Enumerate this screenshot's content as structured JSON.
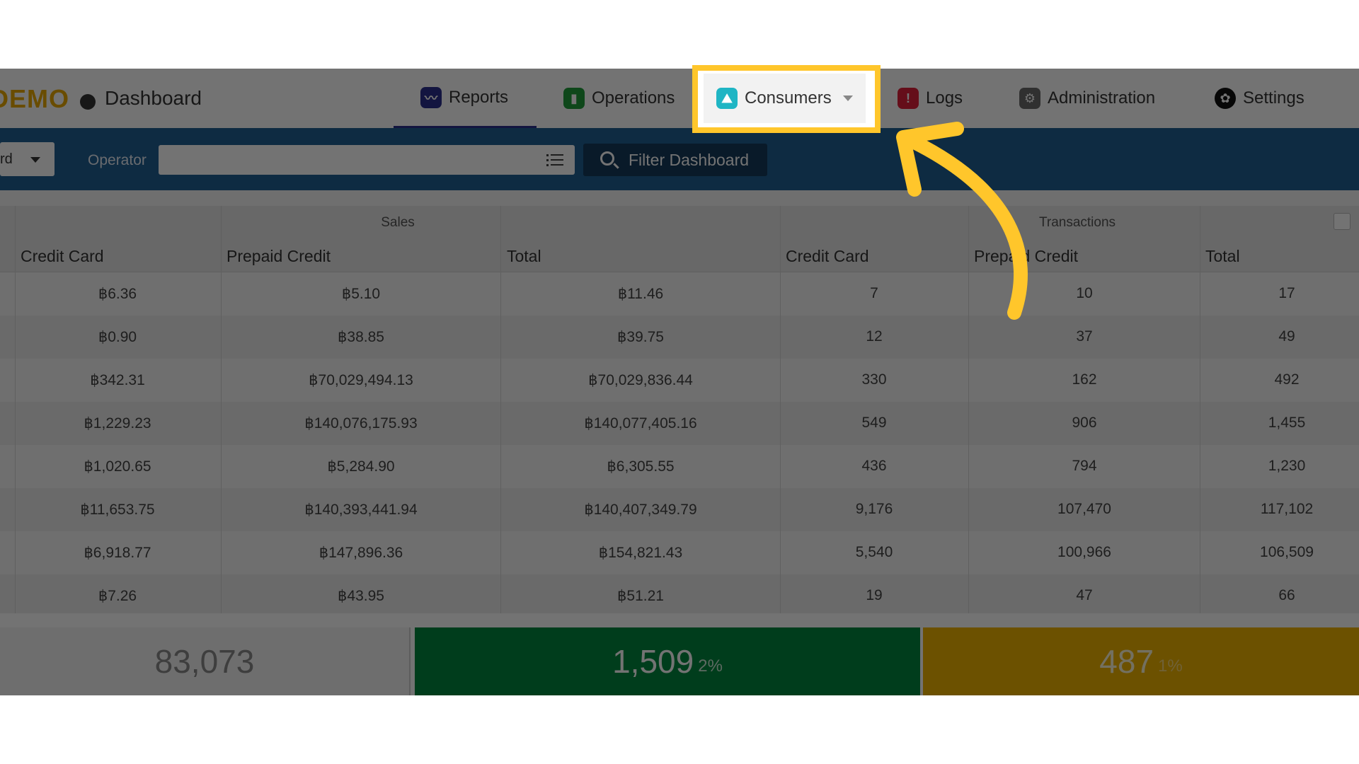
{
  "header": {
    "brand": "DEMO",
    "dashboard_label": "Dashboard"
  },
  "nav": {
    "reports": "Reports",
    "operations": "Operations",
    "consumers": "Consumers",
    "logs": "Logs",
    "administration": "Administration",
    "settings": "Settings"
  },
  "filters": {
    "partial_select_value": "rd",
    "operator_label": "Operator",
    "operator_value": "",
    "filter_button": "Filter Dashboard"
  },
  "table": {
    "groups": {
      "sales": "Sales",
      "transactions": "Transactions"
    },
    "columns": [
      "Credit Card",
      "Prepaid Credit",
      "Total",
      "Credit Card",
      "Prepaid Credit",
      "Total"
    ],
    "rows": [
      [
        "฿6.36",
        "฿5.10",
        "฿11.46",
        "7",
        "10",
        "17"
      ],
      [
        "฿0.90",
        "฿38.85",
        "฿39.75",
        "12",
        "37",
        "49"
      ],
      [
        "฿342.31",
        "฿70,029,494.13",
        "฿70,029,836.44",
        "330",
        "162",
        "492"
      ],
      [
        "฿1,229.23",
        "฿140,076,175.93",
        "฿140,077,405.16",
        "549",
        "906",
        "1,455"
      ],
      [
        "฿1,020.65",
        "฿5,284.90",
        "฿6,305.55",
        "436",
        "794",
        "1,230"
      ],
      [
        "฿11,653.75",
        "฿140,393,441.94",
        "฿140,407,349.79",
        "9,176",
        "107,470",
        "117,102"
      ],
      [
        "฿6,918.77",
        "฿147,896.36",
        "฿154,821.43",
        "5,540",
        "100,966",
        "106,509"
      ],
      [
        "฿7.26",
        "฿43.95",
        "฿51.21",
        "19",
        "47",
        "66"
      ]
    ]
  },
  "summary": {
    "total": "83,073",
    "green_value": "1,509",
    "green_pct": "2%",
    "yellow_value": "487",
    "yellow_pct": "1%"
  },
  "colors": {
    "brand": "#e8a800",
    "filter_bar": "#1f5f92",
    "highlight": "#ffc62b",
    "green_tile": "#00873f",
    "yellow_tile": "#f0b400"
  }
}
